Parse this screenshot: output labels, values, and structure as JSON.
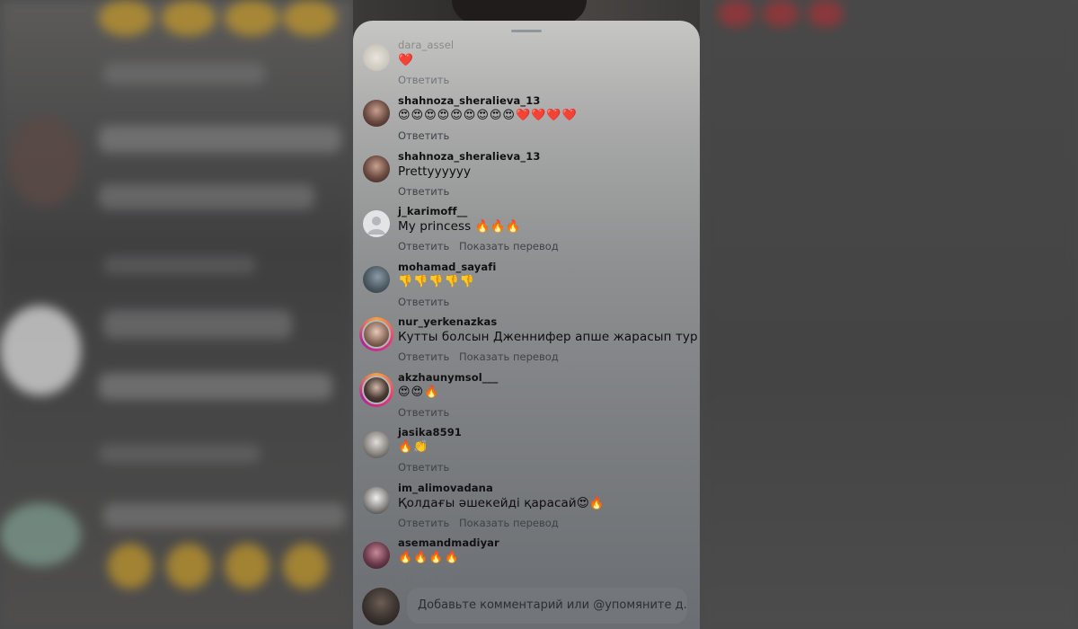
{
  "composer": {
    "placeholder": "Добавьте комментарий или @упомяните д..."
  },
  "comments": [
    {
      "username": "dara_assel",
      "text": "❤️",
      "reply": "Ответить",
      "translate": ""
    },
    {
      "username": "shahnoza_sheralieva_13",
      "text": "😍😍😍😍😍😍😍😍😍❤️❤️❤️❤️",
      "reply": "Ответить",
      "translate": ""
    },
    {
      "username": "shahnoza_sheralieva_13",
      "text": "Prettyyyyyy",
      "reply": "Ответить",
      "translate": ""
    },
    {
      "username": "j_karimoff__",
      "text": "My princess 🔥🔥🔥",
      "reply": "Ответить",
      "translate": "Показать перевод"
    },
    {
      "username": "mohamad_sayafi",
      "text": "👎👎👎👎👎",
      "reply": "Ответить",
      "translate": ""
    },
    {
      "username": "nur_yerkenazkas",
      "text": "Кутты болсын Дженнифер апше жарасып тур",
      "reply": "Ответить",
      "translate": "Показать перевод"
    },
    {
      "username": "akzhaunymsol___",
      "text": "😍😍🔥",
      "reply": "Ответить",
      "translate": ""
    },
    {
      "username": "jasika8591",
      "text": "🔥👏",
      "reply": "Ответить",
      "translate": ""
    },
    {
      "username": "im_alimovadana",
      "text": "Қолдағы әшекейді қарасай😍🔥",
      "reply": "Ответить",
      "translate": "Показать перевод"
    },
    {
      "username": "asemandmadiyar",
      "text": "🔥🔥🔥🔥",
      "reply": "Ответить",
      "translate": ""
    }
  ],
  "colors": {
    "story_ring": "#e8357a",
    "sheet_top": "#c6c6c5",
    "sheet_bottom": "#6a6e72"
  }
}
